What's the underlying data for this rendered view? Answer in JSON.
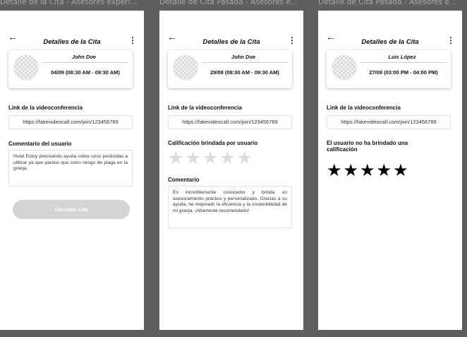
{
  "frames": [
    {
      "frame_title": "Detalle de la Cita - Asesores experi...",
      "header": {
        "back_icon": "arrow-left-icon",
        "title": "Detalles de la Cita",
        "menu_icon": "kebab-menu-icon"
      },
      "card": {
        "name": "John Doe",
        "date": "04/09 (08:30 AM - 09:30 AM)"
      },
      "link_label": "Link de la videoconferencia",
      "link_url": "https://fakevideocall.com/join/123456789",
      "comment_label": "Comentario del usuario",
      "comment_text": "Hola! Estoy precisando ayuda sobre unos pesticidas a utilizar ya que parece que corro riesgo de plaga en la granja.",
      "cancel_label": "Cancelar Cita"
    },
    {
      "frame_title": "Detalle de Cita Pasada - Asesores e...",
      "header": {
        "back_icon": "arrow-left-icon",
        "title": "Detalles de la Cita",
        "menu_icon": "kebab-menu-icon"
      },
      "card": {
        "name": "John Doe",
        "date": "29/08 (08:30 AM - 09:30 AM)"
      },
      "link_label": "Link de la videoconferencia",
      "link_url": "https://fakevideocall.com/join/123456789",
      "rating_label": "Calificación brindada por usuario",
      "rating_stars": "★★★★★",
      "rating_value": 0,
      "comment_label": "Comentario",
      "comment_text": "Es increíblemente conocedor y brinda un asesoramiento práctico y personalizado. Gracias a su ayuda, he mejorado la eficiencia y la sostenibilidad de mi granja. ¡Altamente recomendado!"
    },
    {
      "frame_title": "Detalle de Cita Pasada - Asesores e...",
      "header": {
        "back_icon": "arrow-left-icon",
        "title": "Detalles de la Cita",
        "menu_icon": "kebab-menu-icon"
      },
      "card": {
        "name": "Luis López",
        "date": "27/08 (03:00 PM - 04:00 PM)"
      },
      "link_label": "Link de la videoconferencia",
      "link_url": "https://fakevideocall.com/join/123456789",
      "no_rating_text": "El usuario no ha brindado una calificación",
      "rating_stars": "★★★★★"
    }
  ],
  "colors": {
    "background": "#5f5f5f",
    "phone": "#ffffff",
    "button_disabled": "#d4d4d4",
    "star_empty": "#dcdcdc",
    "star_dark": "#000000"
  }
}
